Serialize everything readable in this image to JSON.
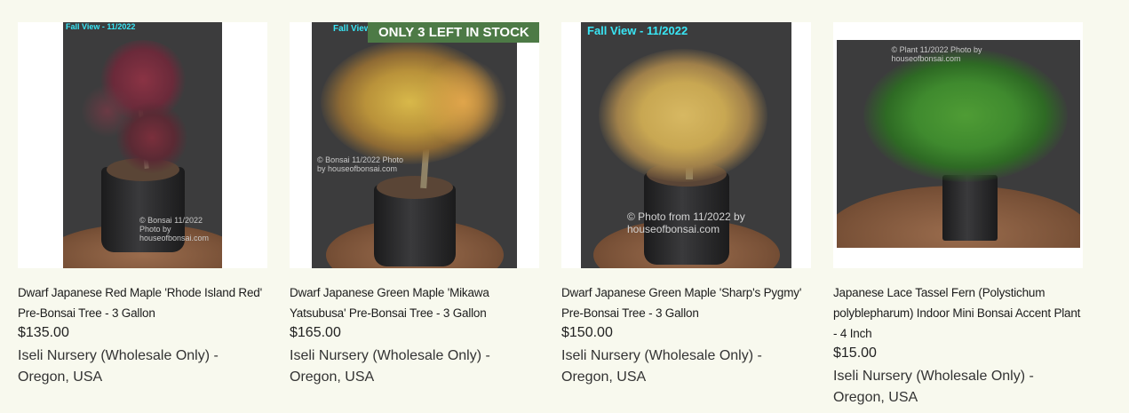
{
  "products": [
    {
      "title": "Dwarf Japanese Red Maple 'Rhode Island Red' Pre-Bonsai Tree - 3 Gallon",
      "price": "$135.00",
      "vendor": "Iseli Nursery (Wholesale Only) - Oregon, USA",
      "image_overlay": "Fall View - 11/2022",
      "image_watermark": "© Bonsai 11/2022 Photo by houseofbonsai.com",
      "foliage_color": "#7a2f3c"
    },
    {
      "title": "Dwarf Japanese Green Maple 'Mikawa Yatsubusa' Pre-Bonsai Tree - 3 Gallon",
      "price": "$165.00",
      "vendor": "Iseli Nursery (Wholesale Only) - Oregon, USA",
      "badge": "ONLY 3 LEFT IN STOCK",
      "image_overlay": "Fall View",
      "image_watermark": "© Bonsai 11/2022 Photo by houseofbonsai.com",
      "foliage_color": "#c9a83a"
    },
    {
      "title": "Dwarf Japanese Green Maple 'Sharp's Pygmy' Pre-Bonsai Tree - 3 Gallon",
      "price": "$150.00",
      "vendor": "Iseli Nursery (Wholesale Only) - Oregon, USA",
      "image_overlay": "Fall View - 11/2022",
      "image_watermark": "© Photo from 11/2022 by houseofbonsai.com",
      "foliage_color": "#c8a752"
    },
    {
      "title": "Japanese Lace Tassel Fern (Polystichum polyblepharum) Indoor Mini Bonsai Accent Plant - 4 Inch",
      "price": "$15.00",
      "vendor": "Iseli Nursery (Wholesale Only) - Oregon, USA",
      "image_watermark": "© Plant 11/2022 Photo by houseofbonsai.com",
      "foliage_color": "#3f8a2e"
    }
  ],
  "colors": {
    "background": "#f8f9ee",
    "badge": "#4d7a46",
    "overlay_text": "#39e6f5"
  }
}
